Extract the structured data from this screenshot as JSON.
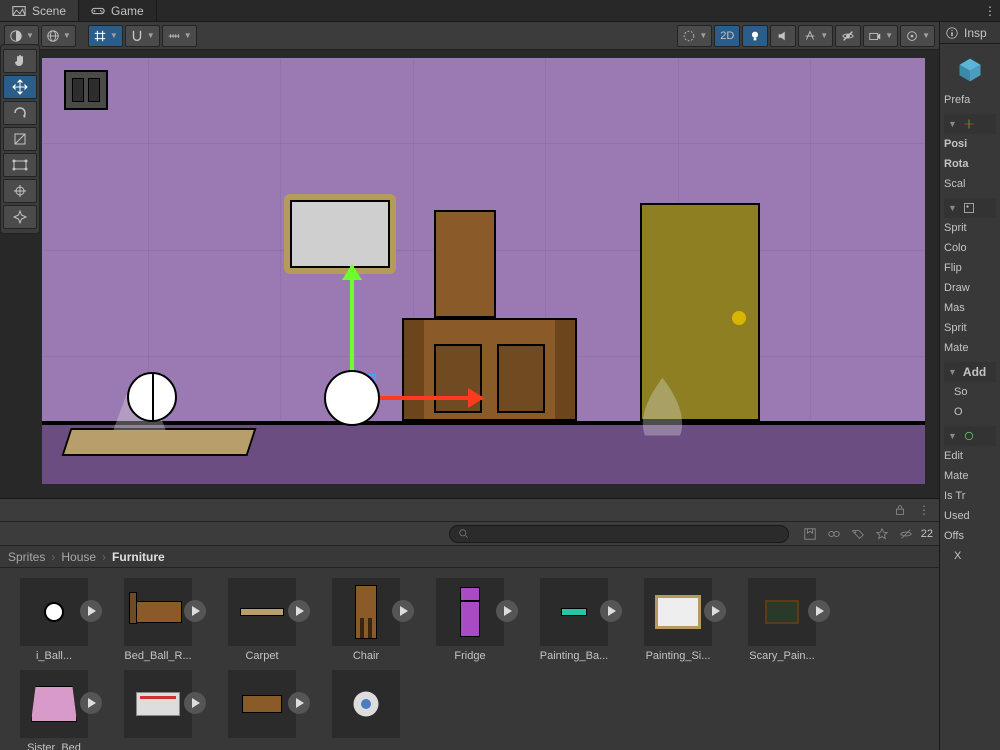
{
  "tabs": {
    "scene": "Scene",
    "game": "Game"
  },
  "scene_toolbar": {
    "mode_2d": "2D"
  },
  "project": {
    "search_placeholder": "",
    "hidden_count": "22",
    "breadcrumb": [
      "Sprites",
      "House",
      "Furniture"
    ],
    "assets": [
      {
        "label": "i_Ball..."
      },
      {
        "label": "Bed_Ball_R..."
      },
      {
        "label": "Carpet"
      },
      {
        "label": "Chair"
      },
      {
        "label": "Fridge"
      },
      {
        "label": "Painting_Ba..."
      },
      {
        "label": "Painting_Si..."
      },
      {
        "label": "Scary_Pain..."
      },
      {
        "label": "Sister_Bed"
      }
    ]
  },
  "inspector": {
    "tab": "Insp",
    "prefab": "Prefa",
    "transform": {
      "pos": "Posi",
      "rot": "Rota",
      "scale": "Scal"
    },
    "sprite_renderer": {
      "sprite": "Sprit",
      "color": "Colo",
      "flip": "Flip",
      "draw": "Draw",
      "mask": "Mas",
      "sprite2": "Sprit",
      "mat": "Mate"
    },
    "additional": {
      "title": "Add",
      "sort": "So",
      "order": "O"
    },
    "circle_collider": {
      "edit": "Edit",
      "mat": "Mate",
      "istrigger": "Is Tr",
      "used": "Used",
      "offset": "Offs",
      "x": "X"
    }
  }
}
